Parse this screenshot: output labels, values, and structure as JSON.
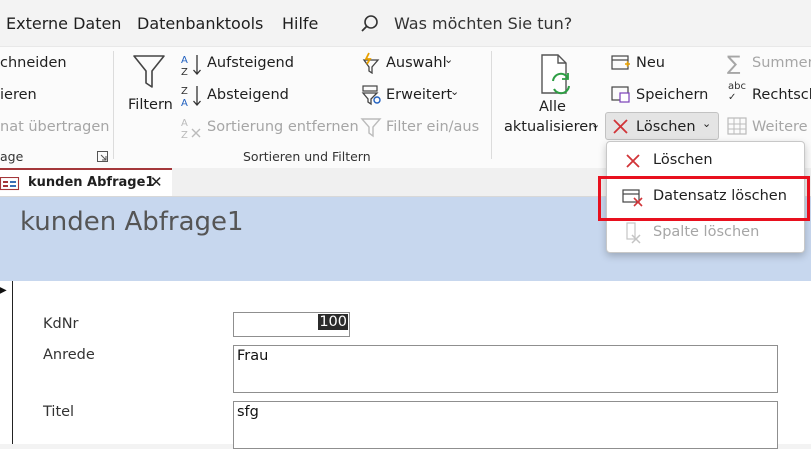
{
  "menu": {
    "items": [
      {
        "label": "Externe Daten"
      },
      {
        "label": "Datenbanktools"
      },
      {
        "label": "Hilfe"
      }
    ],
    "search_placeholder": "Was möchten Sie tun?"
  },
  "ribbon": {
    "clipboard": {
      "cut_label": "chneiden",
      "copy_label": "ieren",
      "format_painter_label": "nat übertragen",
      "group_label": "age"
    },
    "sort_filter": {
      "filter_label": "Filtern",
      "ascending_label": "Aufsteigend",
      "descending_label": "Absteigend",
      "remove_sort_label": "Sortierung entfernen",
      "selection_label": "Auswahl",
      "advanced_label": "Erweitert",
      "toggle_filter_label": "Filter ein/aus",
      "group_label": "Sortieren und Filtern"
    },
    "records": {
      "refresh_line1": "Alle",
      "refresh_line2": "aktualisieren",
      "new_label": "Neu",
      "save_label": "Speichern",
      "delete_label": "Löschen",
      "totals_label": "Summen",
      "spelling_label": "Rechtsch",
      "more_label": "Weitere O"
    }
  },
  "dropdown": {
    "items": [
      {
        "label": "Löschen",
        "enabled": true
      },
      {
        "label": "Datensatz löschen",
        "enabled": true
      },
      {
        "label": "Spalte löschen",
        "enabled": false
      }
    ]
  },
  "tab": {
    "title": "kunden Abfrage1"
  },
  "form": {
    "title": "kunden Abfrage1",
    "fields": [
      {
        "label": "KdNr",
        "value": "100"
      },
      {
        "label": "Anrede",
        "value": "Frau"
      },
      {
        "label": "Titel",
        "value": "sfg"
      }
    ]
  },
  "colors": {
    "accent_red": "#e8101e",
    "delete_x": "#d13438",
    "form_header": "#c7d7ee",
    "tab_accent": "#a4373a"
  }
}
